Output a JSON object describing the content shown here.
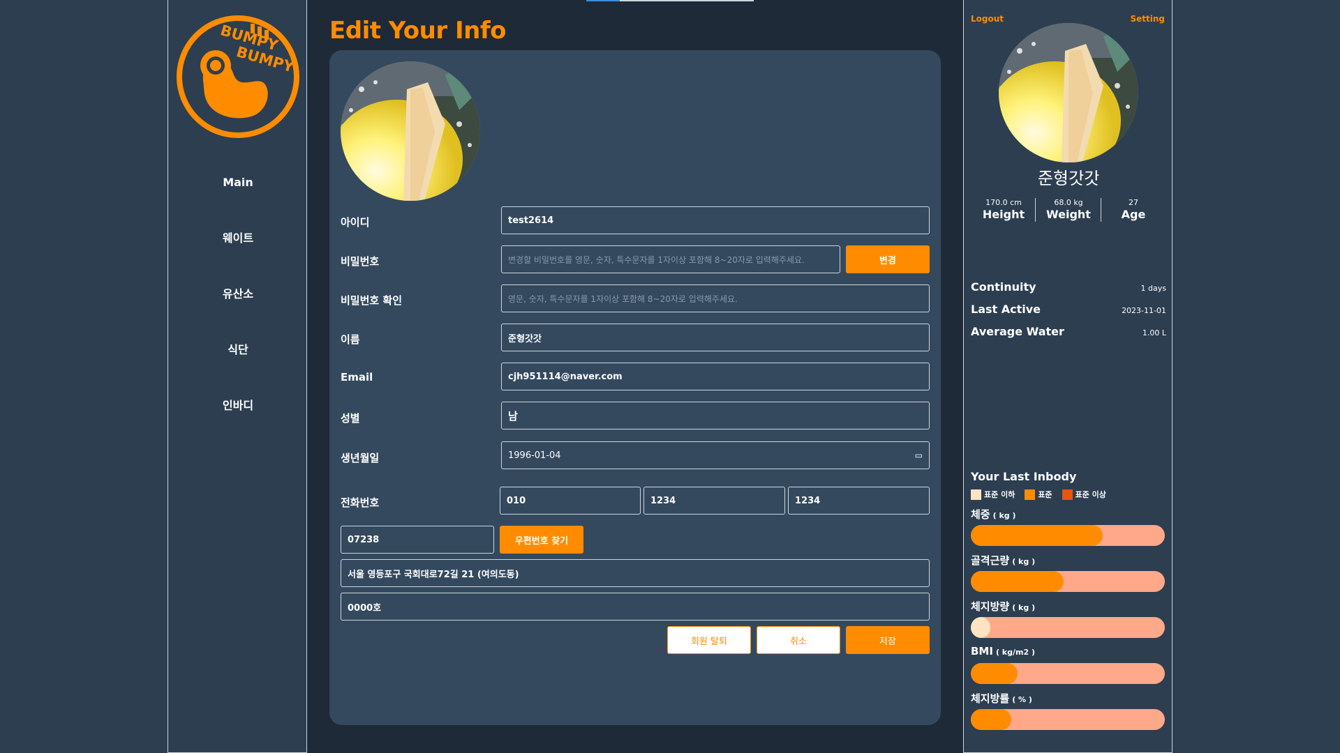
{
  "sidebar": {
    "logo_text": [
      "BUMPY",
      "BUMPY"
    ],
    "items": [
      {
        "label": "Main"
      },
      {
        "label": "웨이트"
      },
      {
        "label": "유산소"
      },
      {
        "label": "식단"
      },
      {
        "label": "인바디"
      }
    ]
  },
  "main": {
    "title": "Edit Your Info",
    "form": {
      "id_label": "아이디",
      "id_value": "test2614",
      "password_label": "비밀번호",
      "password_placeholder": "변경할 비밀번호를 영문, 숫자, 특수문자를 1자이상 포함해 8~20자로 입력해주세요.",
      "password_change_button": "변경",
      "password_confirm_label": "비밀번호 확인",
      "password_confirm_placeholder": "영문, 숫자, 특수문자를 1자이상 포함해 8~20자로 입력해주세요.",
      "name_label": "이름",
      "name_value": "준형갓갓",
      "email_label": "Email",
      "email_value": "cjh951114@naver.com",
      "gender_label": "성별",
      "gender_value": "남",
      "birth_label": "생년월일",
      "birth_value": "1996-01-04",
      "phone_label": "전화번호",
      "phone_1": "010",
      "phone_2": "1234",
      "phone_3": "1234",
      "postcode_value": "07238",
      "postcode_button": "우편번호 찾기",
      "address_value": "서울 영등포구 국회대로72길 21 (여의도동)",
      "address_detail_value": "0000호",
      "withdraw_button": "회원 탈퇴",
      "cancel_button": "취소",
      "save_button": "저장"
    }
  },
  "right": {
    "logout": "Logout",
    "setting": "Setting",
    "username": "준형갓갓",
    "stats": [
      {
        "value": "170.0 cm",
        "label": "Height"
      },
      {
        "value": "68.0 kg",
        "label": "Weight"
      },
      {
        "value": "27",
        "label": "Age"
      }
    ],
    "info": [
      {
        "key": "Continuity",
        "value": "1 days"
      },
      {
        "key": "Last Active",
        "value": "2023-11-01"
      },
      {
        "key": "Average Water",
        "value": "1.00 L"
      }
    ],
    "inbody_title": "Your Last Inbody",
    "legend": [
      {
        "label": "표준 이하",
        "color": "#ffe4c4"
      },
      {
        "label": "표준",
        "color": "#ff8c00"
      },
      {
        "label": "표준 이상",
        "color": "#e8550f"
      }
    ],
    "metrics": [
      {
        "label": "체중",
        "unit": "( kg )",
        "fraction": 0.68,
        "fill_color": "#ff8c00"
      },
      {
        "label": "골격근량",
        "unit": "( kg )",
        "fraction": 0.48,
        "fill_color": "#ff8c00"
      },
      {
        "label": "체지방량",
        "unit": "( kg )",
        "fraction": 0.1,
        "fill_color": "#ffe4c4"
      },
      {
        "label": "BMI",
        "unit": "( kg/m2 )",
        "fraction": 0.24,
        "fill_color": "#ff8c00"
      },
      {
        "label": "체지방률",
        "unit": "( % )",
        "fraction": 0.21,
        "fill_color": "#ff8c00"
      }
    ]
  },
  "colors": {
    "accent": "#ff8c00",
    "panel": "#34495e",
    "background": "#2c3e50",
    "bar_track": "#ffa88a"
  }
}
